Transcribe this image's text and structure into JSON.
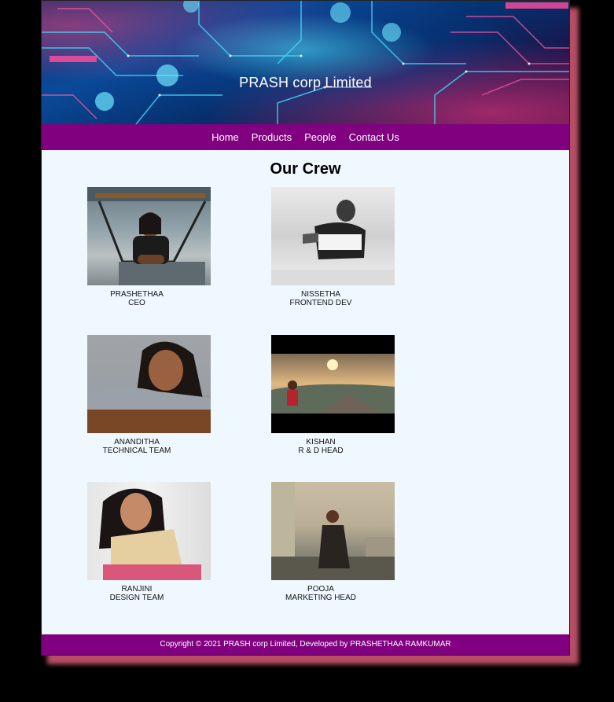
{
  "site": {
    "title": "PRASH corp Limited"
  },
  "nav": {
    "items": [
      "Home",
      "Products",
      "People",
      "Contact Us"
    ]
  },
  "main": {
    "heading": "Our Crew",
    "crew": [
      {
        "name": "PRASHETHAA",
        "role": "CEO"
      },
      {
        "name": "NISSETHA",
        "role": "FRONTEND DEV"
      },
      {
        "name": "ANANDITHA",
        "role": "TECHNICAL TEAM"
      },
      {
        "name": "KISHAN",
        "role": "R & D HEAD"
      },
      {
        "name": "RANJINI",
        "role": "DESIGN TEAM"
      },
      {
        "name": "POOJA",
        "role": "MARKETING HEAD"
      }
    ]
  },
  "footer": {
    "text": "Copyright © 2021 PRASH corp Limited, Developed by PRASHETHAA RAMKUMAR"
  },
  "colors": {
    "nav_bg": "#800080",
    "page_bg": "#f0f8ff",
    "outer_bg": "#000000",
    "shadow": "#c9576f"
  }
}
